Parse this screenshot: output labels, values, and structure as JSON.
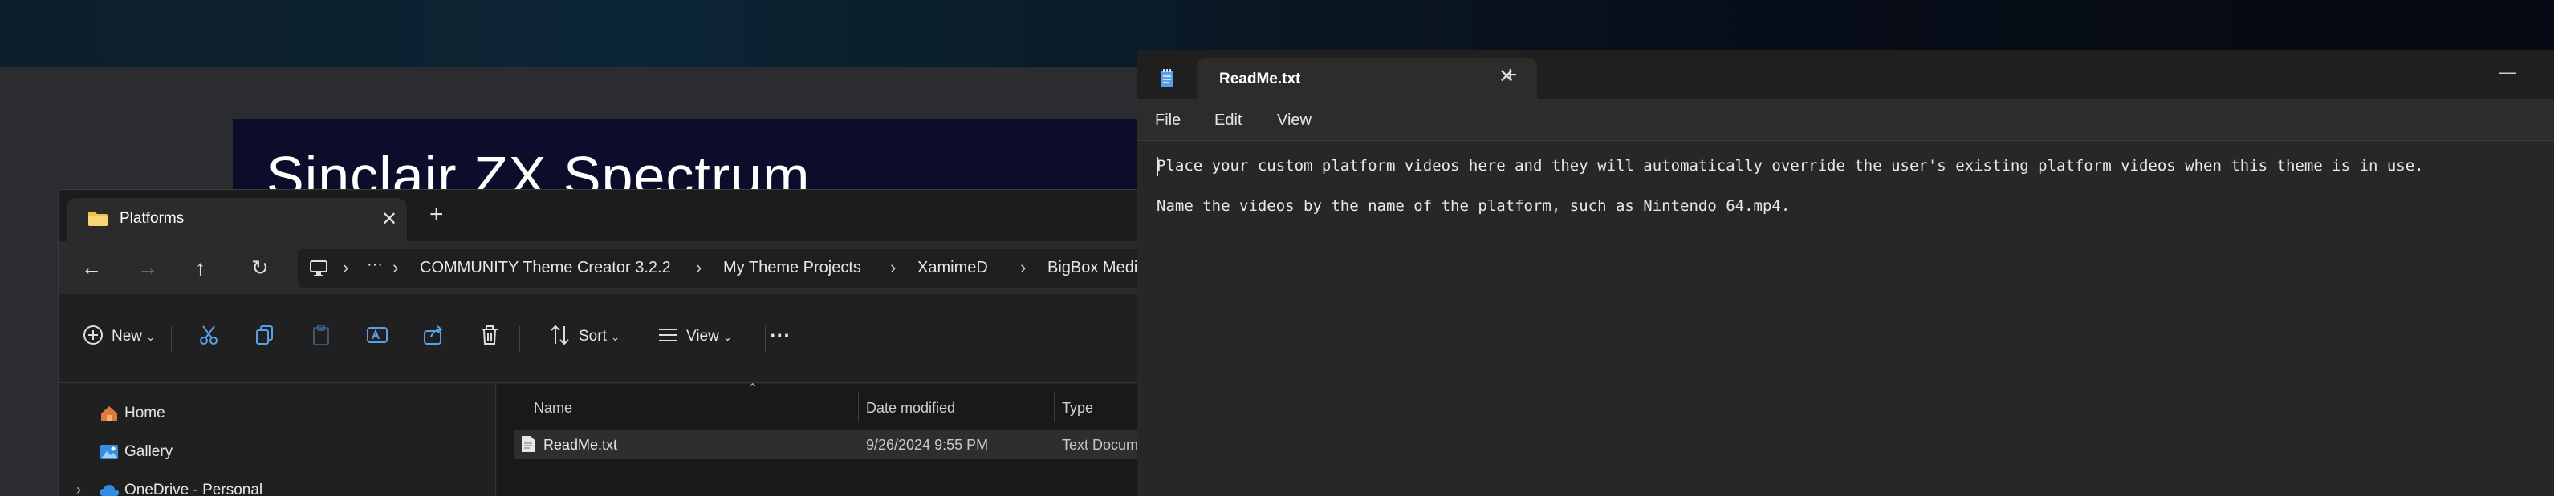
{
  "desktop": {
    "video_title": "Sinclair ZX Spectrum"
  },
  "explorer": {
    "tab_label": "Platforms",
    "address_crumbs": [
      "COMMUNITY Theme Creator 3.2.2",
      "My Theme Projects",
      "XamimeD",
      "BigBox Medi"
    ],
    "address_more": "···",
    "toolbar": {
      "new_label": "New",
      "sort_label": "Sort",
      "view_label": "View",
      "more_label": "···"
    },
    "sidebar": {
      "items": [
        {
          "label": "Home",
          "icon": "home-icon"
        },
        {
          "label": "Gallery",
          "icon": "gallery-icon"
        },
        {
          "label": "OneDrive - Personal",
          "icon": "cloud-icon"
        }
      ]
    },
    "columns": {
      "name": "Name",
      "date": "Date modified",
      "type": "Type"
    },
    "files": [
      {
        "name": "ReadMe.txt",
        "date": "9/26/2024 9:55 PM",
        "type": "Text Docum"
      }
    ]
  },
  "notepad": {
    "tab_label": "ReadMe.txt",
    "menu": [
      "File",
      "Edit",
      "View"
    ],
    "lines": [
      "Place your custom platform videos here and they will automatically override the user's existing platform videos when this theme is in use.",
      "Name the videos by the name of the platform, such as Nintendo 64.mp4."
    ]
  },
  "colors": {
    "accent": "#5aa0e8",
    "folder": "#f2c14e"
  }
}
